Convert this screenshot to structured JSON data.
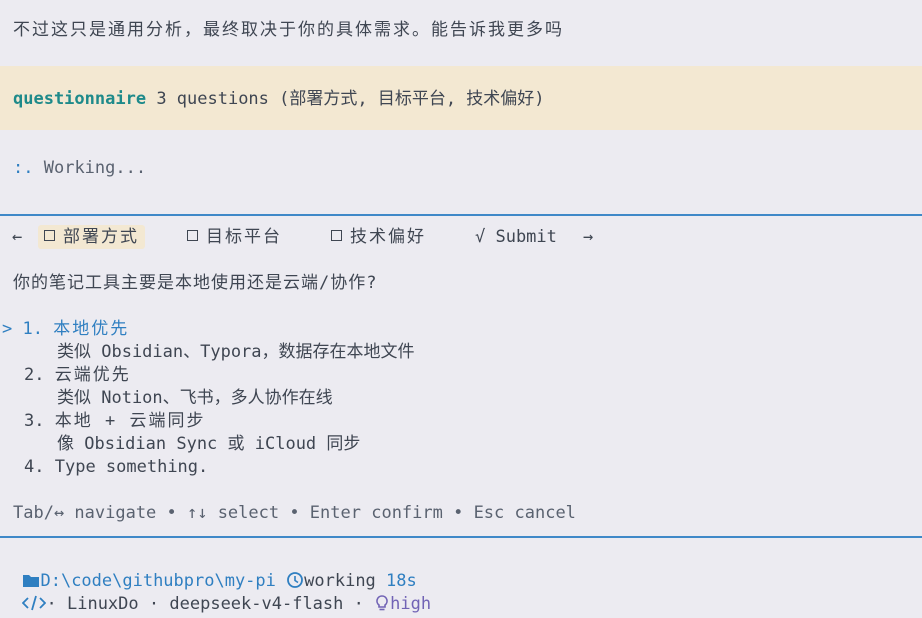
{
  "intro_text": "不过这只是通用分析，最终取决于你的具体需求。能告诉我更多吗",
  "banner": {
    "tool_name": "questionnaire",
    "summary": "3 questions (部署方式, 目标平台, 技术偏好)"
  },
  "status_line": {
    "spinner": ":.",
    "text": "Working..."
  },
  "tabs": {
    "back_arrow": "←",
    "forward_arrow": "→",
    "items": [
      {
        "label": "部署方式",
        "checked": false,
        "active": true
      },
      {
        "label": "目标平台",
        "checked": false,
        "active": false
      },
      {
        "label": "技术偏好",
        "checked": false,
        "active": false
      }
    ],
    "submit_label": "√ Submit"
  },
  "question": "你的笔记工具主要是本地使用还是云端/协作?",
  "options": [
    {
      "marker": ">",
      "number": "1.",
      "title": "本地优先",
      "desc": "类似 Obsidian、Typora，数据存在本地文件",
      "selected": true
    },
    {
      "marker": "",
      "number": "2.",
      "title": "云端优先",
      "desc": "类似 Notion、飞书，多人协作在线",
      "selected": false
    },
    {
      "marker": "",
      "number": "3.",
      "title": "本地 + 云端同步",
      "desc": "像 Obsidian Sync 或 iCloud 同步",
      "selected": false
    },
    {
      "marker": "",
      "number": "4.",
      "title": "Type something.",
      "desc": "",
      "selected": false
    }
  ],
  "help_text": "Tab/↔ navigate • ↑↓ select • Enter confirm • Esc cancel",
  "footer": {
    "folder_icon": "folder-icon",
    "path": "D:\\code\\githubpro\\my-pi",
    "clock_icon": "clock-icon",
    "working_label": "working",
    "elapsed": "18s",
    "provider_icon": "code-icon",
    "provider_suffix": "·",
    "provider": "LinuxDo",
    "separator": "·",
    "model": "deepseek-v4-flash",
    "separator2": "·",
    "thinking_icon": "lightbulb-icon",
    "thinking_level": "high"
  },
  "colors": {
    "background": "#ecebf1",
    "banner": "#f3e8d2",
    "accent_blue": "#2f7fc1",
    "teal": "#1e8a8a",
    "purple": "#7163b5",
    "rule": "#3f88c8"
  }
}
